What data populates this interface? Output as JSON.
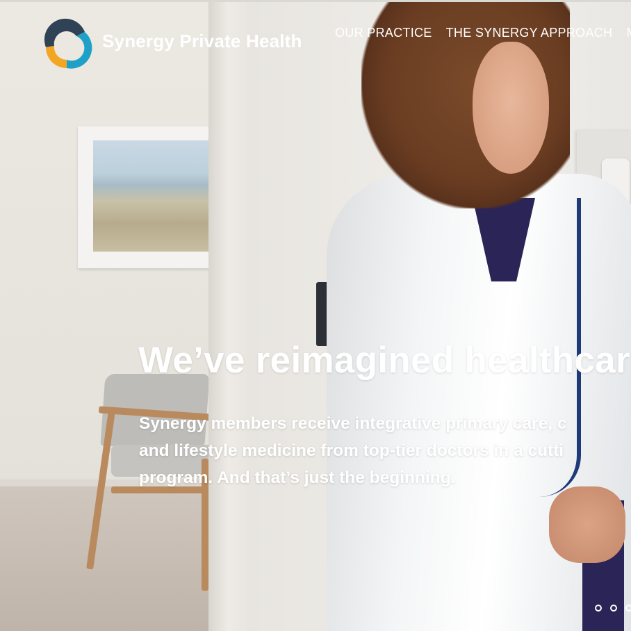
{
  "brand": {
    "name": "Synergy Private Health"
  },
  "nav": {
    "items": [
      {
        "label": "OUR PRACTICE"
      },
      {
        "label": "THE SYNERGY APPROACH"
      },
      {
        "label": "ME"
      }
    ]
  },
  "hero": {
    "headline": "We’ve reimagined healthcar",
    "sub_lines": [
      "Synergy members receive integrative primary care, c",
      "and lifestyle medicine from top-tier doctors in a cutti",
      "program. And that’s just the beginning."
    ]
  },
  "carousel": {
    "dot_count": 3,
    "active_index": 0
  },
  "colors": {
    "logo_navy": "#2f4256",
    "logo_blue": "#1ea0c8",
    "logo_orange": "#f2a623",
    "text": "#ffffff"
  }
}
